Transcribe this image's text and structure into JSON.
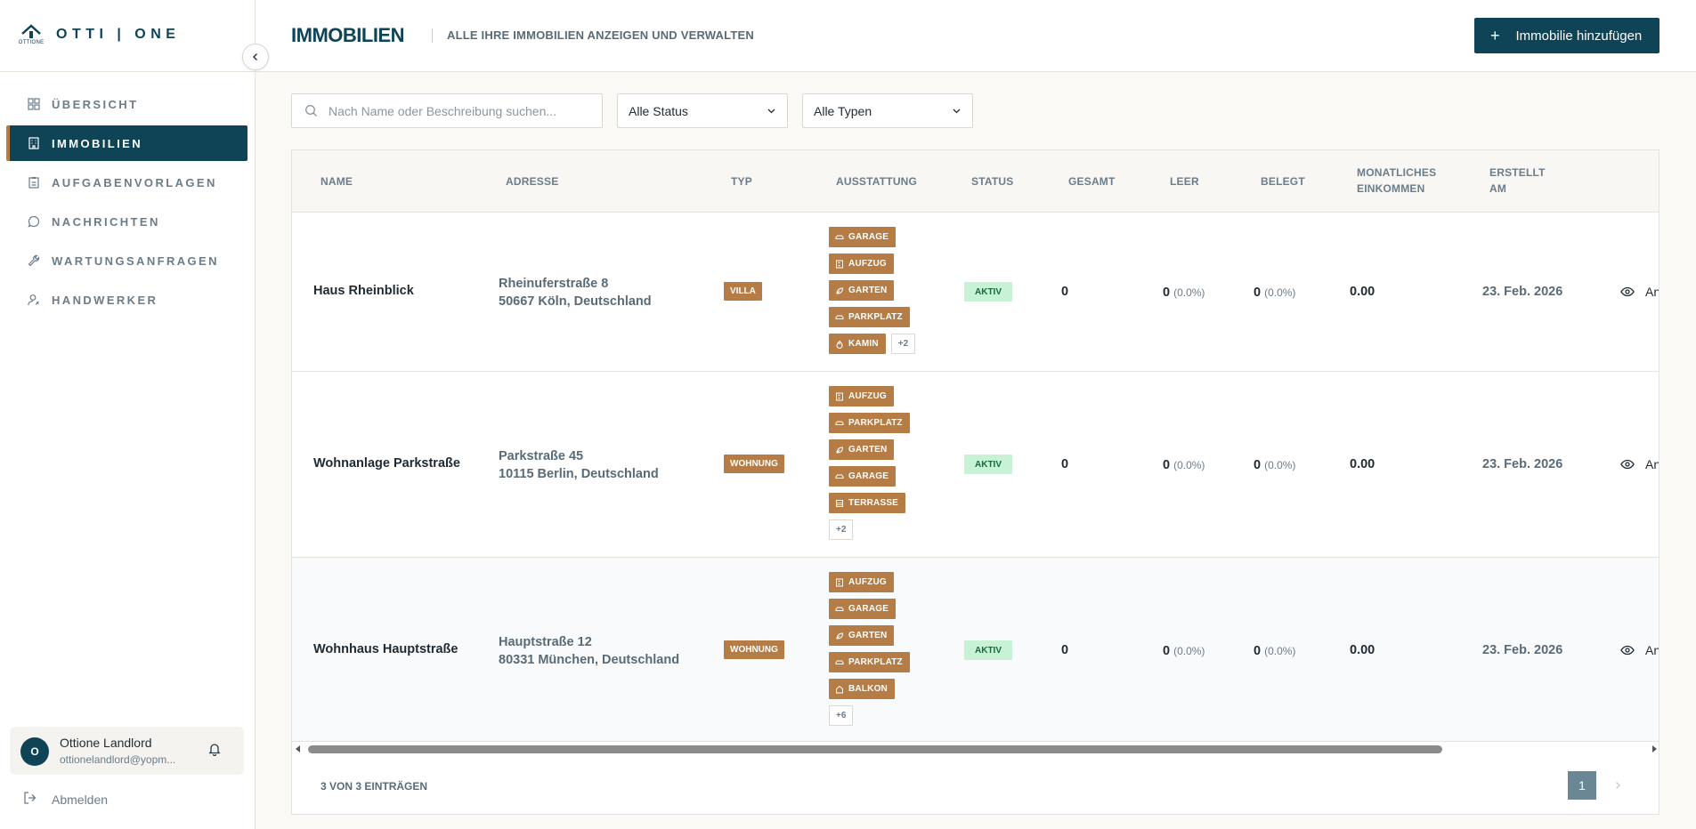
{
  "brand": {
    "logo_sub": "OTTIONE",
    "name": "OTTI | ONE"
  },
  "sidebar": {
    "items": [
      {
        "label": "ÜBERSICHT",
        "icon": "dashboard-icon"
      },
      {
        "label": "IMMOBILIEN",
        "icon": "building-icon"
      },
      {
        "label": "AUFGABENVORLAGEN",
        "icon": "clipboard-icon"
      },
      {
        "label": "NACHRICHTEN",
        "icon": "chat-icon"
      },
      {
        "label": "WARTUNGSANFRAGEN",
        "icon": "wrench-icon"
      },
      {
        "label": "HANDWERKER",
        "icon": "worker-icon"
      }
    ],
    "user": {
      "initial": "O",
      "name": "Ottione Landlord",
      "email": "ottionelandlord@yopm..."
    },
    "logout_label": "Abmelden"
  },
  "header": {
    "title": "IMMOBILIEN",
    "subtitle": "ALLE IHRE IMMOBILIEN ANZEIGEN UND VERWALTEN",
    "add_label": "Immobilie hinzufügen"
  },
  "filters": {
    "search_placeholder": "Nach Name oder Beschreibung suchen...",
    "status_value": "Alle Status",
    "type_value": "Alle Typen"
  },
  "table": {
    "headers": {
      "name": "NAME",
      "address": "ADRESSE",
      "type": "TYP",
      "amenities": "AUSSTATTUNG",
      "status": "STATUS",
      "total": "GESAMT",
      "vacant": "LEER",
      "occupied": "BELEGT",
      "income_1": "MONATLICHES",
      "income_2": "EINKOMMEN",
      "created_1": "ERSTELLT",
      "created_2": "AM"
    },
    "rows": [
      {
        "name": "Haus Rheinblick",
        "address_line1": "Rheinuferstraße 8",
        "address_line2": "50667 Köln, Deutschland",
        "type": "VILLA",
        "amenities": [
          "GARAGE",
          "AUFZUG",
          "GARTEN",
          "PARKPLATZ",
          "KAMIN"
        ],
        "amenities_more": "+2",
        "status": "AKTIV",
        "total": "0",
        "vacant": "0",
        "vacant_pct": "(0.0%)",
        "occupied": "0",
        "occupied_pct": "(0.0%)",
        "income": "0.00",
        "created": "23. Feb. 2026",
        "action": "An"
      },
      {
        "name": "Wohnanlage Parkstraße",
        "address_line1": "Parkstraße 45",
        "address_line2": "10115 Berlin, Deutschland",
        "type": "WOHNUNG",
        "amenities": [
          "AUFZUG",
          "PARKPLATZ",
          "GARTEN",
          "GARAGE",
          "TERRASSE"
        ],
        "amenities_more": "+2",
        "status": "AKTIV",
        "total": "0",
        "vacant": "0",
        "vacant_pct": "(0.0%)",
        "occupied": "0",
        "occupied_pct": "(0.0%)",
        "income": "0.00",
        "created": "23. Feb. 2026",
        "action": "An"
      },
      {
        "name": "Wohnhaus Hauptstraße",
        "address_line1": "Hauptstraße 12",
        "address_line2": "80331 München, Deutschland",
        "type": "WOHNUNG",
        "amenities": [
          "AUFZUG",
          "GARAGE",
          "GARTEN",
          "PARKPLATZ",
          "BALKON"
        ],
        "amenities_more": "+6",
        "status": "AKTIV",
        "total": "0",
        "vacant": "0",
        "vacant_pct": "(0.0%)",
        "occupied": "0",
        "occupied_pct": "(0.0%)",
        "income": "0.00",
        "created": "23. Feb. 2026",
        "action": "An"
      }
    ],
    "count_text": "3 VON 3 EINTRÄGEN",
    "page": "1"
  },
  "colors": {
    "primary": "#0f4457",
    "accent": "#b67c46",
    "status_bg": "#c7f2d6"
  }
}
